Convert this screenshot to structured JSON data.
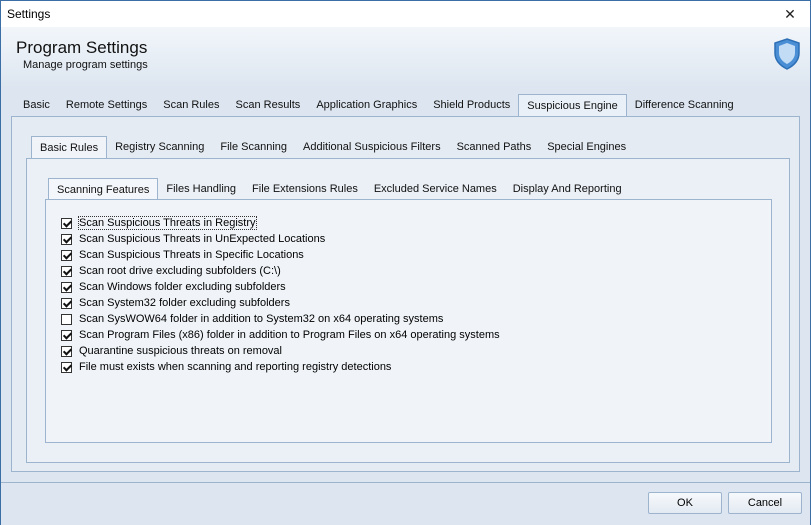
{
  "window": {
    "title": "Settings",
    "close_glyph": "✕"
  },
  "header": {
    "title": "Program Settings",
    "subtitle": "Manage program settings",
    "icon": "shield-icon"
  },
  "main_tabs": [
    {
      "label": "Basic",
      "active": false
    },
    {
      "label": "Remote Settings",
      "active": false
    },
    {
      "label": "Scan Rules",
      "active": false
    },
    {
      "label": "Scan Results",
      "active": false
    },
    {
      "label": "Application Graphics",
      "active": false
    },
    {
      "label": "Shield Products",
      "active": false
    },
    {
      "label": "Suspicious Engine",
      "active": true
    },
    {
      "label": "Difference Scanning",
      "active": false
    }
  ],
  "sub_tabs": [
    {
      "label": "Basic Rules",
      "active": true
    },
    {
      "label": "Registry Scanning",
      "active": false
    },
    {
      "label": "File Scanning",
      "active": false
    },
    {
      "label": "Additional Suspicious Filters",
      "active": false
    },
    {
      "label": "Scanned Paths",
      "active": false
    },
    {
      "label": "Special Engines",
      "active": false
    }
  ],
  "inner_tabs": [
    {
      "label": "Scanning Features",
      "active": true
    },
    {
      "label": "Files Handling",
      "active": false
    },
    {
      "label": "File Extensions Rules",
      "active": false
    },
    {
      "label": "Excluded Service Names",
      "active": false
    },
    {
      "label": "Display And Reporting",
      "active": false
    }
  ],
  "options": [
    {
      "label": "Scan Suspicious Threats in Registry",
      "checked": true
    },
    {
      "label": "Scan Suspicious Threats in UnExpected Locations",
      "checked": true
    },
    {
      "label": "Scan Suspicious Threats in Specific Locations",
      "checked": true
    },
    {
      "label": "Scan root drive excluding subfolders (C:\\)",
      "checked": true
    },
    {
      "label": "Scan Windows folder excluding subfolders",
      "checked": true
    },
    {
      "label": "Scan System32 folder excluding subfolders",
      "checked": true
    },
    {
      "label": "Scan SysWOW64 folder in addition to System32 on x64 operating systems",
      "checked": false
    },
    {
      "label": "Scan Program Files (x86) folder in addition to Program Files on x64 operating systems",
      "checked": true
    },
    {
      "label": "Quarantine suspicious threats on removal",
      "checked": true
    },
    {
      "label": "File must exists when scanning and reporting registry detections",
      "checked": true
    }
  ],
  "buttons": {
    "ok": "OK",
    "cancel": "Cancel"
  }
}
